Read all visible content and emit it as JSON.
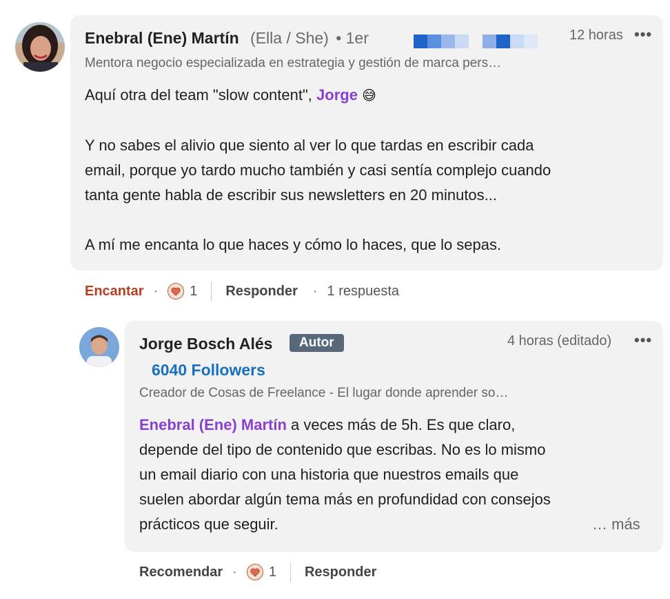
{
  "comment": {
    "author_name": "Enebral (Ene) Martín",
    "pronouns": "(Ella / She)",
    "degree": "• 1er",
    "headline": "Mentora negocio especializada en estrategia y gestión de marca pers…",
    "time": "12 horas",
    "more_icon": "•••",
    "line1_prefix": "Aquí otra del team \"slow content\", ",
    "line1_mention": "Jorge",
    "line1_emoji": "😅",
    "para2_line1": "Y no sabes el alivio que siento al ver lo que tardas en escribir cada",
    "para2_line2": "email, porque yo tardo mucho también y casi sentía complejo cuando",
    "para2_line3": "tanta gente habla de escribir sus newsletters en 20 minutos...",
    "para3": "A mí me encanta lo que haces y cómo lo haces, que lo sepas.",
    "actions": {
      "react_label": "Encantar",
      "reaction_count": "1",
      "reply_label": "Responder",
      "replies_text": "1 respuesta"
    },
    "colors": {
      "react_label": "#b24020"
    }
  },
  "reply": {
    "author_name": "Jorge Bosch Alés",
    "badge": "Autor",
    "followers": "6040 Followers",
    "headline": "Creador de Cosas de Freelance - El lugar donde aprender so…",
    "time": "4 horas (editado)",
    "more_icon": "•••",
    "mention": "Enebral (Ene) Martín",
    "line1_rest": " a veces más de 5h. Es que claro,",
    "line2": "depende del tipo de contenido que escribas. No es lo mismo",
    "line3": "un email diario con una historia que nuestros emails que",
    "line4": "suelen abordar algún tema más en profundidad con consejos",
    "line5": "prácticos que seguir.",
    "see_more": "… más",
    "actions": {
      "react_label": "Recomendar",
      "reaction_count": "1",
      "reply_label": "Responder"
    }
  }
}
